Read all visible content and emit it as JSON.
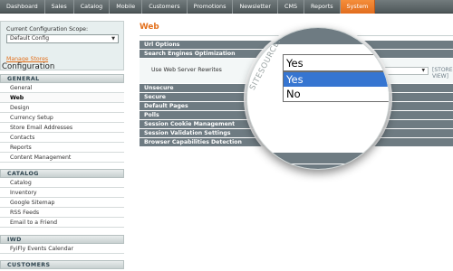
{
  "topnav": {
    "items": [
      "Dashboard",
      "Sales",
      "Catalog",
      "Mobile",
      "Customers",
      "Promotions",
      "Newsletter",
      "CMS",
      "Reports",
      "System"
    ],
    "active_index": 9,
    "active_color": "#eb7d2a"
  },
  "sidebar": {
    "scope_label": "Current Configuration Scope:",
    "scope_value": "Default Config",
    "manage_stores": "Manage Stores",
    "configuration_title": "Configuration",
    "groups": [
      {
        "header": "GENERAL",
        "items": [
          "General",
          "Web",
          "Design",
          "Currency Setup",
          "Store Email Addresses",
          "Contacts",
          "Reports",
          "Content Management"
        ],
        "selected": "Web"
      },
      {
        "header": "CATALOG",
        "items": [
          "Catalog",
          "Inventory",
          "Google Sitemap",
          "RSS Feeds",
          "Email to a Friend"
        ]
      },
      {
        "header": "IWD",
        "items": [
          "FyiFly Events Calendar"
        ]
      },
      {
        "header": "CUSTOMERS",
        "items": []
      }
    ]
  },
  "main": {
    "title": "Web",
    "sections_before": [
      "Url Options",
      "Search Engines Optimization"
    ],
    "field_label": "Use Web Server Rewrites",
    "field_value": "Yes",
    "scope_tag": "[STORE VIEW]",
    "sections_after": [
      "Unsecure",
      "Secure",
      "Default Pages",
      "Polls",
      "Session Cookie Management",
      "Session Validation Settings",
      "Browser Capabilities Detection"
    ]
  },
  "magnifier": {
    "watermark": "SITESOURCE.COM",
    "selected_value": "Yes",
    "options": [
      "Yes",
      "No"
    ],
    "highlighted": "Yes",
    "highlight_color": "#3675d1"
  }
}
